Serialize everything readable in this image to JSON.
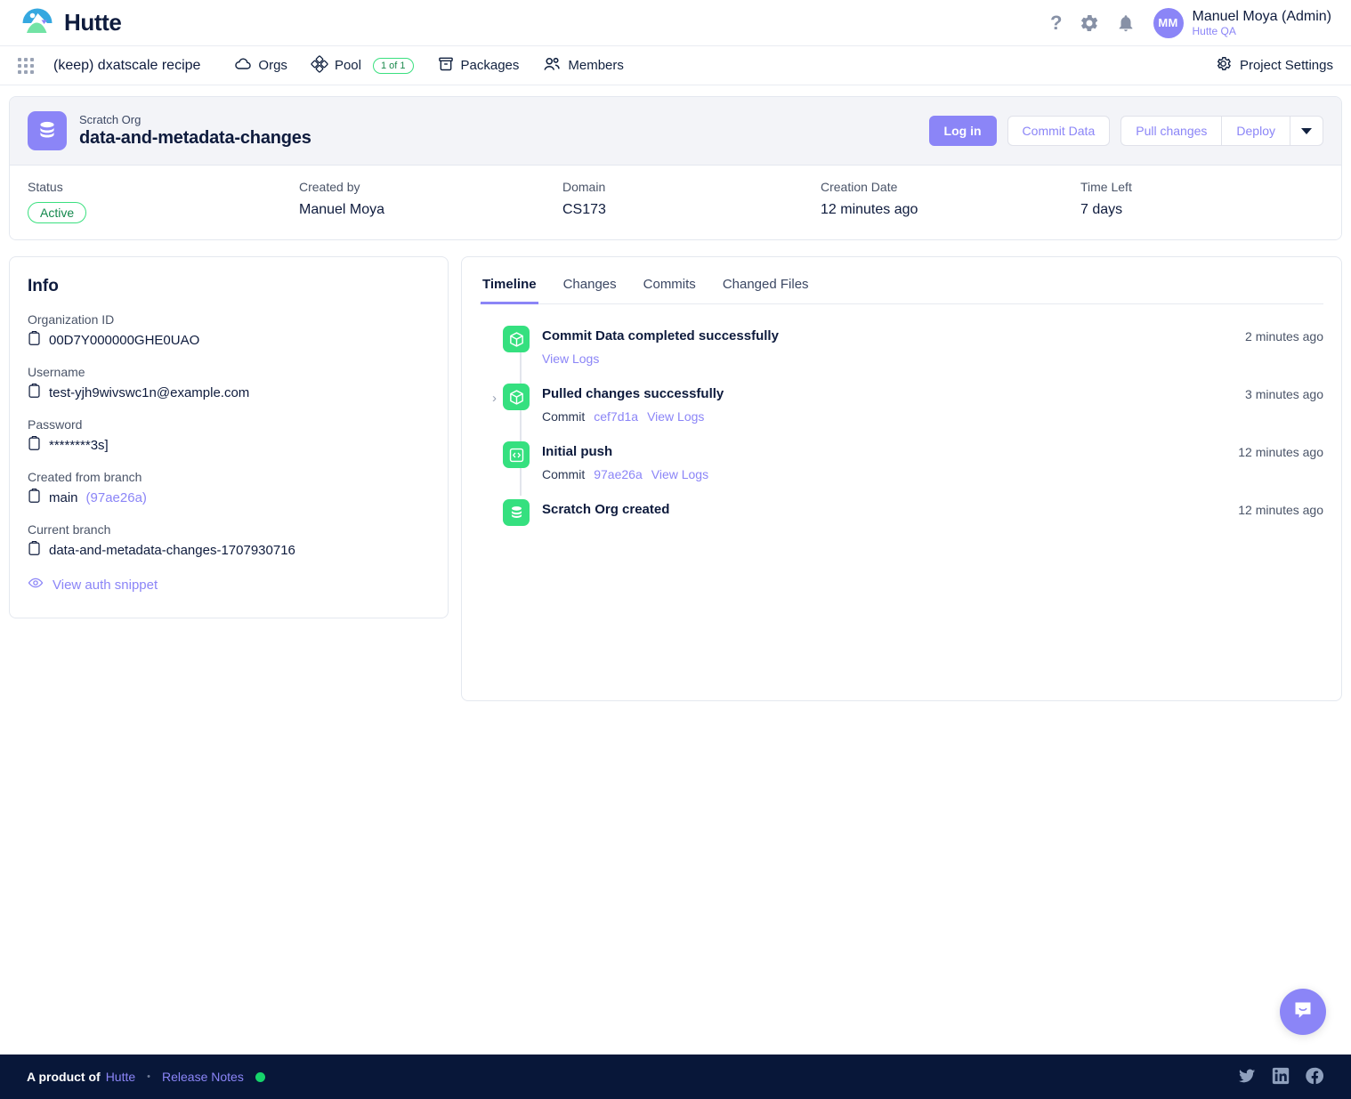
{
  "app": {
    "brand_name": "Hutte",
    "logo_icon": "mountain-photo-logo"
  },
  "topbar": {
    "help_icon": "question-mark-icon",
    "settings_icon": "gear-icon",
    "notifications_icon": "bell-icon",
    "avatar_initials": "MM",
    "user_name": "Manuel Moya (Admin)",
    "user_org": "Hutte QA"
  },
  "subnav": {
    "apps_icon": "grid-apps-icon",
    "project_name": "(keep) dxatscale recipe",
    "items": [
      {
        "label": "Orgs",
        "icon": "cloud-icon"
      },
      {
        "label": "Pool",
        "icon": "pool-diamond-icon",
        "count": "1 of 1"
      },
      {
        "label": "Packages",
        "icon": "package-box-icon"
      },
      {
        "label": "Members",
        "icon": "users-icon"
      }
    ],
    "project_settings_label": "Project Settings",
    "project_settings_icon": "gear-icon"
  },
  "org": {
    "icon": "database-stack-icon",
    "kind": "Scratch Org",
    "title": "data-and-metadata-changes",
    "actions": {
      "login": "Log in",
      "commit_data": "Commit Data",
      "pull_changes": "Pull changes",
      "deploy": "Deploy",
      "more_icon": "chevron-down-icon"
    },
    "meta": [
      {
        "label": "Status",
        "value": "Active",
        "type": "badge"
      },
      {
        "label": "Created by",
        "value": "Manuel Moya",
        "type": "text"
      },
      {
        "label": "Domain",
        "value": "CS173",
        "type": "text"
      },
      {
        "label": "Creation Date",
        "value": "12 minutes ago",
        "type": "text"
      },
      {
        "label": "Time Left",
        "value": "7 days",
        "type": "text"
      }
    ]
  },
  "info": {
    "title": "Info",
    "rows": [
      {
        "label": "Organization ID",
        "value": "00D7Y000000GHE0UAO",
        "copy_icon": "copy-clipboard-icon"
      },
      {
        "label": "Username",
        "value": "test-yjh9wivswc1n@example.com",
        "copy_icon": "copy-clipboard-icon"
      },
      {
        "label": "Password",
        "value": "********3s]",
        "copy_icon": "copy-clipboard-icon"
      },
      {
        "label": "Created from branch",
        "value": "main",
        "extra": "(97ae26a)",
        "copy_icon": "copy-clipboard-icon"
      },
      {
        "label": "Current branch",
        "value": "data-and-metadata-changes-1707930716",
        "copy_icon": "copy-clipboard-icon"
      }
    ],
    "auth_snippet_label": "View auth snippet",
    "auth_snippet_icon": "eye-icon"
  },
  "timeline_panel": {
    "tabs": [
      {
        "label": "Timeline",
        "active": true
      },
      {
        "label": "Changes",
        "active": false
      },
      {
        "label": "Commits",
        "active": false
      },
      {
        "label": "Changed Files",
        "active": false
      }
    ],
    "events": [
      {
        "title": "Commit Data completed successfully",
        "icon": "cube-icon",
        "time": "2 minutes ago",
        "expandable": false,
        "sub_commit_label": null,
        "sub_commit_hash": null,
        "logs_label": "View Logs"
      },
      {
        "title": "Pulled changes successfully",
        "icon": "cube-icon",
        "time": "3 minutes ago",
        "expandable": true,
        "chevron_icon": "chevron-right-icon",
        "sub_commit_label": "Commit",
        "sub_commit_hash": "cef7d1a",
        "logs_label": "View Logs"
      },
      {
        "title": "Initial push",
        "icon": "code-brackets-icon",
        "time": "12 minutes ago",
        "expandable": false,
        "sub_commit_label": "Commit",
        "sub_commit_hash": "97ae26a",
        "logs_label": "View Logs"
      },
      {
        "title": "Scratch Org created",
        "icon": "database-stack-icon",
        "time": "12 minutes ago",
        "expandable": false,
        "sub_commit_label": null,
        "sub_commit_hash": null,
        "logs_label": null
      }
    ]
  },
  "footer": {
    "product_of": "A product of",
    "brand": "Hutte",
    "separator": "•",
    "release_notes": "Release Notes",
    "status_indicator": "green-status-dot",
    "socials": [
      {
        "name": "twitter-icon"
      },
      {
        "name": "linkedin-icon"
      },
      {
        "name": "facebook-icon"
      }
    ]
  },
  "chat": {
    "icon": "intercom-chat-icon"
  },
  "colors": {
    "accent": "#8b85f7",
    "success": "#35e07f",
    "dark": "#081739",
    "text": "#0e1b3d"
  }
}
